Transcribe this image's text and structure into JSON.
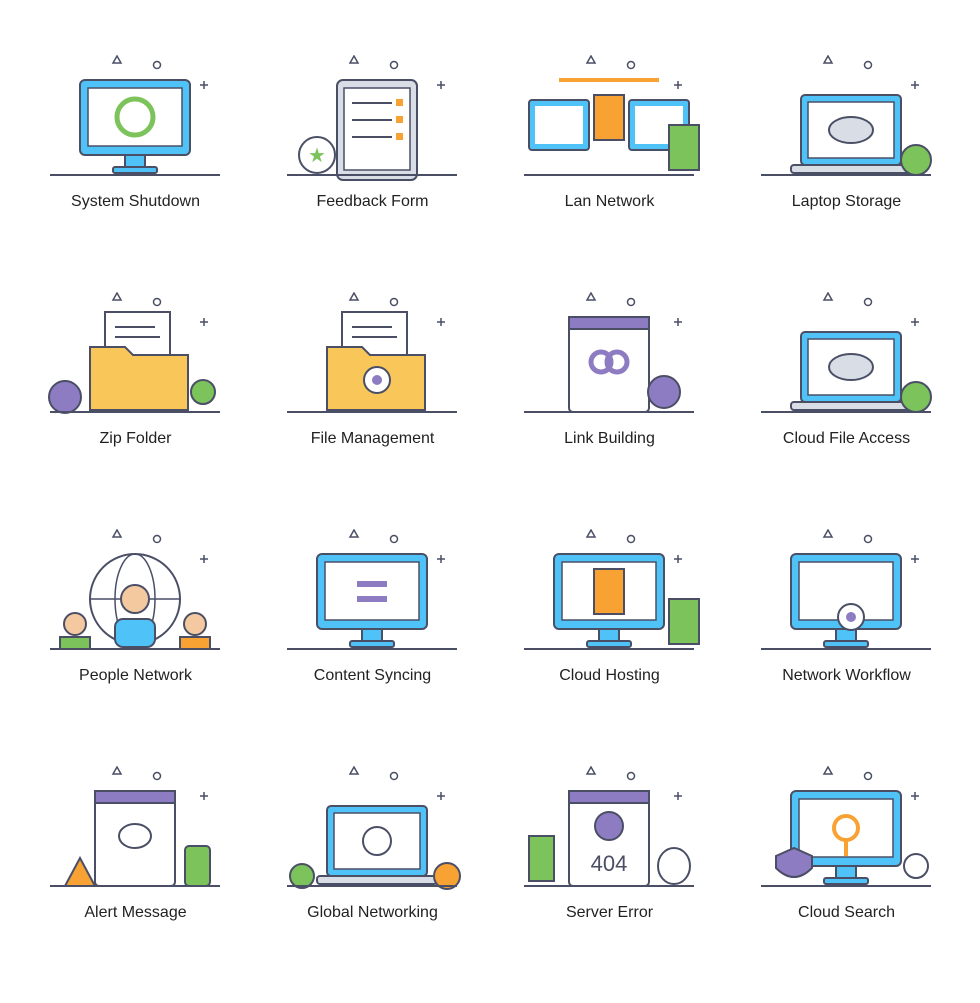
{
  "colors": {
    "outline": "#4a4f66",
    "blue": "#4fc3f7",
    "purple": "#8e7cc3",
    "green": "#7cc35b",
    "orange": "#f7a233",
    "yellow": "#f9c65a",
    "gray": "#d9dde6"
  },
  "icons": [
    {
      "label": "System Shutdown",
      "icon": "monitor",
      "accent": "power"
    },
    {
      "label": "Feedback Form",
      "icon": "tablet",
      "accent": "star"
    },
    {
      "label": "Lan Network",
      "icon": "dual-monitor",
      "accent": "server"
    },
    {
      "label": "Laptop Storage",
      "icon": "laptop",
      "accent": "cloud"
    },
    {
      "label": "Zip Folder",
      "icon": "folder",
      "accent": "lock"
    },
    {
      "label": "File Management",
      "icon": "folder",
      "accent": "gear"
    },
    {
      "label": "Link Building",
      "icon": "browser",
      "accent": "link"
    },
    {
      "label": "Cloud File Access",
      "icon": "laptop",
      "accent": "cloud"
    },
    {
      "label": "People Network",
      "icon": "globe",
      "accent": "people"
    },
    {
      "label": "Content Syncing",
      "icon": "monitor",
      "accent": "sync"
    },
    {
      "label": "Cloud Hosting",
      "icon": "monitor",
      "accent": "server"
    },
    {
      "label": "Network Workflow",
      "icon": "monitor",
      "accent": "gear"
    },
    {
      "label": "Alert Message",
      "icon": "browser",
      "accent": "warning"
    },
    {
      "label": "Global Networking",
      "icon": "laptop",
      "accent": "globe"
    },
    {
      "label": "Server Error",
      "icon": "browser",
      "accent": "404"
    },
    {
      "label": "Cloud Search",
      "icon": "monitor",
      "accent": "search"
    }
  ],
  "error_code": "404"
}
